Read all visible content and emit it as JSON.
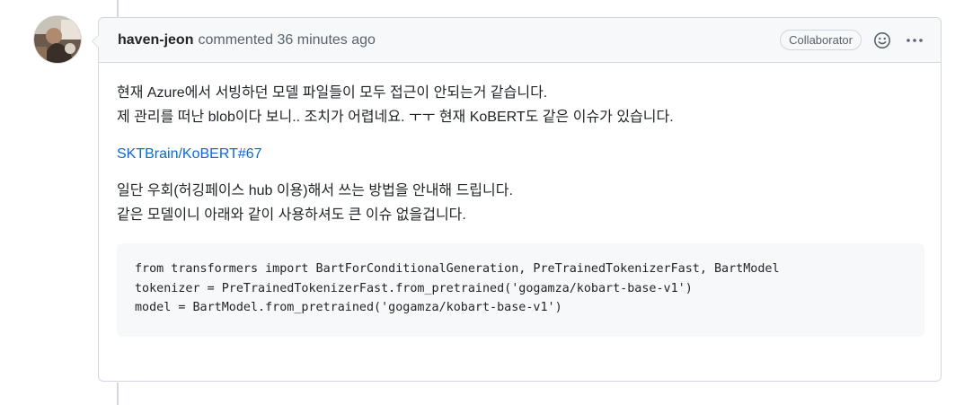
{
  "comment": {
    "author": "haven-jeon",
    "action": "commented",
    "time": "36 minutes ago",
    "badge": "Collaborator",
    "icons": {
      "reaction": "smiley-icon",
      "more": "kebab-horizontal-icon"
    },
    "body": {
      "paragraph1": [
        "현재 Azure에서 서빙하던 모델 파일들이 모두 접근이 안되는거 같습니다.",
        "제 관리를 떠난 blob이다 보니.. 조치가 어렵네요. ㅜㅜ 현재 KoBERT도 같은 이슈가 있습니다."
      ],
      "link": "SKTBrain/KoBERT#67",
      "paragraph3": [
        "일단 우회(허깅페이스 hub 이용)해서 쓰는 방법을 안내해 드립니다.",
        "같은 모델이니 아래와 같이 사용하셔도 큰 이슈 없을겁니다."
      ],
      "code": [
        "from transformers import BartForConditionalGeneration, PreTrainedTokenizerFast, BartModel",
        "tokenizer = PreTrainedTokenizerFast.from_pretrained('gogamza/kobart-base-v1')",
        "model = BartModel.from_pretrained('gogamza/kobart-base-v1')"
      ]
    }
  },
  "colors": {
    "link": "#0969da",
    "border": "#d0d7de",
    "header_bg": "#f6f8fa",
    "muted": "#59636e"
  }
}
